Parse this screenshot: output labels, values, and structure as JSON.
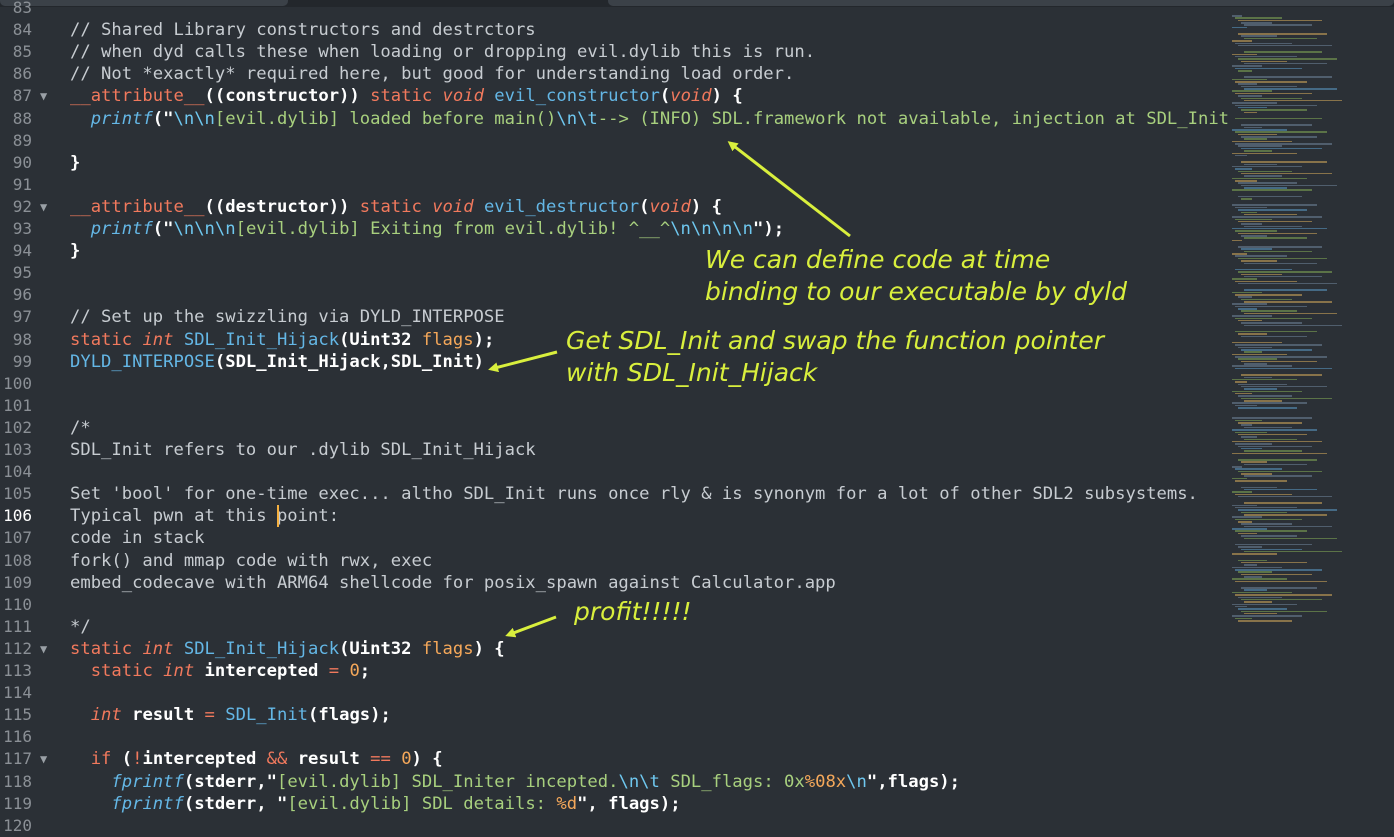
{
  "editor": {
    "current_line": "106",
    "lines": [
      {
        "n": "83",
        "fold": false,
        "tokens": []
      },
      {
        "n": "84",
        "fold": false,
        "tokens": [
          [
            "// Shared Library constructors and destrctors",
            "comment"
          ]
        ]
      },
      {
        "n": "85",
        "fold": false,
        "tokens": [
          [
            "// when dyd calls these when loading or dropping evil.dylib this is run.",
            "comment"
          ]
        ]
      },
      {
        "n": "86",
        "fold": false,
        "tokens": [
          [
            "// Not *exactly* required here, but good for understanding load order.",
            "comment"
          ]
        ]
      },
      {
        "n": "87",
        "fold": true,
        "tokens": [
          [
            "__attribute__",
            "kw"
          ],
          [
            "((constructor)) ",
            "bold"
          ],
          [
            "static ",
            "kw"
          ],
          [
            "void ",
            "type"
          ],
          [
            "evil_constructor",
            "fn"
          ],
          [
            "(",
            "bold"
          ],
          [
            "void",
            "type"
          ],
          [
            ") {",
            "bold"
          ]
        ]
      },
      {
        "n": "88",
        "fold": false,
        "tokens": [
          [
            "  ",
            "plain"
          ],
          [
            "printf",
            "call"
          ],
          [
            "(\"",
            "bold"
          ],
          [
            "\\n\\n",
            "esc"
          ],
          [
            "[evil.dylib] loaded before main()",
            "str"
          ],
          [
            "\\n\\t",
            "esc"
          ],
          [
            "--> (INFO) SDL.framework not available, injection at SDL_Init()",
            "str"
          ]
        ]
      },
      {
        "n": "89",
        "fold": false,
        "tokens": []
      },
      {
        "n": "90",
        "fold": false,
        "tokens": [
          [
            "}",
            "bold"
          ]
        ]
      },
      {
        "n": "91",
        "fold": false,
        "tokens": []
      },
      {
        "n": "92",
        "fold": true,
        "tokens": [
          [
            "__attribute__",
            "kw"
          ],
          [
            "((destructor)) ",
            "bold"
          ],
          [
            "static ",
            "kw"
          ],
          [
            "void ",
            "type"
          ],
          [
            "evil_destructor",
            "fn"
          ],
          [
            "(",
            "bold"
          ],
          [
            "void",
            "type"
          ],
          [
            ") {",
            "bold"
          ]
        ]
      },
      {
        "n": "93",
        "fold": false,
        "tokens": [
          [
            "  ",
            "plain"
          ],
          [
            "printf",
            "call"
          ],
          [
            "(\"",
            "bold"
          ],
          [
            "\\n\\n\\n",
            "esc"
          ],
          [
            "[evil.dylib] Exiting from evil.dylib! ^__^",
            "str"
          ],
          [
            "\\n\\n\\n\\n",
            "esc"
          ],
          [
            "\");",
            "bold"
          ]
        ]
      },
      {
        "n": "94",
        "fold": false,
        "tokens": [
          [
            "}",
            "bold"
          ]
        ]
      },
      {
        "n": "95",
        "fold": false,
        "tokens": []
      },
      {
        "n": "96",
        "fold": false,
        "tokens": []
      },
      {
        "n": "97",
        "fold": false,
        "tokens": [
          [
            "// Set up the swizzling via DYLD_INTERPOSE",
            "comment"
          ]
        ]
      },
      {
        "n": "98",
        "fold": false,
        "tokens": [
          [
            "static ",
            "kw"
          ],
          [
            "int ",
            "type"
          ],
          [
            "SDL_Init_Hijack",
            "fn"
          ],
          [
            "(Uint32 ",
            "bold"
          ],
          [
            "flags",
            "param"
          ],
          [
            ");",
            "bold"
          ]
        ]
      },
      {
        "n": "99",
        "fold": false,
        "tokens": [
          [
            "DYLD_INTERPOSE",
            "fn"
          ],
          [
            "(SDL_Init_Hijack,SDL_Init)",
            "bold"
          ]
        ]
      },
      {
        "n": "100",
        "fold": false,
        "tokens": []
      },
      {
        "n": "101",
        "fold": false,
        "tokens": []
      },
      {
        "n": "102",
        "fold": false,
        "tokens": [
          [
            "/*",
            "comment"
          ]
        ]
      },
      {
        "n": "103",
        "fold": false,
        "tokens": [
          [
            "SDL_Init refers to our .dylib SDL_Init_Hijack",
            "comment"
          ]
        ]
      },
      {
        "n": "104",
        "fold": false,
        "tokens": []
      },
      {
        "n": "105",
        "fold": false,
        "tokens": [
          [
            "Set 'bool' for one-time exec... altho SDL_Init runs once rly & is synonym for a lot of other SDL2 subsystems.",
            "comment"
          ]
        ]
      },
      {
        "n": "106",
        "fold": false,
        "tokens": [
          [
            "Typical pwn at this point:",
            "comment"
          ]
        ]
      },
      {
        "n": "107",
        "fold": false,
        "tokens": [
          [
            "code in stack",
            "comment"
          ]
        ]
      },
      {
        "n": "108",
        "fold": false,
        "tokens": [
          [
            "fork() and mmap code with rwx, exec",
            "comment"
          ]
        ]
      },
      {
        "n": "109",
        "fold": false,
        "tokens": [
          [
            "embed_codecave with ARM64 shellcode for posix_spawn against Calculator.app",
            "comment"
          ]
        ]
      },
      {
        "n": "110",
        "fold": false,
        "tokens": []
      },
      {
        "n": "111",
        "fold": false,
        "tokens": [
          [
            "*/",
            "comment"
          ]
        ]
      },
      {
        "n": "112",
        "fold": true,
        "tokens": [
          [
            "static ",
            "kw"
          ],
          [
            "int ",
            "type"
          ],
          [
            "SDL_Init_Hijack",
            "fn"
          ],
          [
            "(Uint32 ",
            "bold"
          ],
          [
            "flags",
            "param"
          ],
          [
            ") {",
            "bold"
          ]
        ]
      },
      {
        "n": "113",
        "fold": false,
        "tokens": [
          [
            "  ",
            "plain"
          ],
          [
            "static ",
            "kw"
          ],
          [
            "int ",
            "type"
          ],
          [
            "intercepted ",
            "bold"
          ],
          [
            "= ",
            "op"
          ],
          [
            "0",
            "num"
          ],
          [
            ";",
            "bold"
          ]
        ]
      },
      {
        "n": "114",
        "fold": false,
        "tokens": []
      },
      {
        "n": "115",
        "fold": false,
        "tokens": [
          [
            "  ",
            "plain"
          ],
          [
            "int ",
            "type"
          ],
          [
            "result ",
            "bold"
          ],
          [
            "= ",
            "op"
          ],
          [
            "SDL_Init",
            "fn"
          ],
          [
            "(flags);",
            "bold"
          ]
        ]
      },
      {
        "n": "116",
        "fold": false,
        "tokens": []
      },
      {
        "n": "117",
        "fold": true,
        "tokens": [
          [
            "  ",
            "plain"
          ],
          [
            "if ",
            "kw"
          ],
          [
            "(",
            "bold"
          ],
          [
            "!",
            "op"
          ],
          [
            "intercepted ",
            "bold"
          ],
          [
            "&& ",
            "op"
          ],
          [
            "result ",
            "bold"
          ],
          [
            "== ",
            "op"
          ],
          [
            "0",
            "num"
          ],
          [
            ") {",
            "bold"
          ]
        ]
      },
      {
        "n": "118",
        "fold": false,
        "tokens": [
          [
            "    ",
            "plain"
          ],
          [
            "fprintf",
            "call"
          ],
          [
            "(stderr,\"",
            "bold"
          ],
          [
            "[evil.dylib] SDL_Initer incepted.",
            "str"
          ],
          [
            "\\n\\t",
            "esc"
          ],
          [
            " SDL_flags: 0x",
            "str"
          ],
          [
            "%08x",
            "num"
          ],
          [
            "\\n",
            "esc"
          ],
          [
            "\",flags);",
            "bold"
          ]
        ]
      },
      {
        "n": "119",
        "fold": false,
        "tokens": [
          [
            "    ",
            "plain"
          ],
          [
            "fprintf",
            "call"
          ],
          [
            "(stderr, \"",
            "bold"
          ],
          [
            "[evil.dylib] SDL details: ",
            "str"
          ],
          [
            "%d",
            "num"
          ],
          [
            "\", flags);",
            "bold"
          ]
        ]
      },
      {
        "n": "120",
        "fold": false,
        "tokens": []
      }
    ]
  },
  "annotations": {
    "note1_line1": "We can define code at time",
    "note1_line2": "binding to our executable by dyld",
    "note2_line1": "Get SDL_Init and swap the function pointer",
    "note2_line2": "with SDL_Init_Hijack",
    "note3": "profit!!!!!"
  },
  "colors": {
    "background": "#2b3036",
    "annotation": "#d9ef3d",
    "keyword": "#f1795d",
    "function": "#64b7e6",
    "string": "#a8d07e",
    "number": "#f5a85a"
  }
}
